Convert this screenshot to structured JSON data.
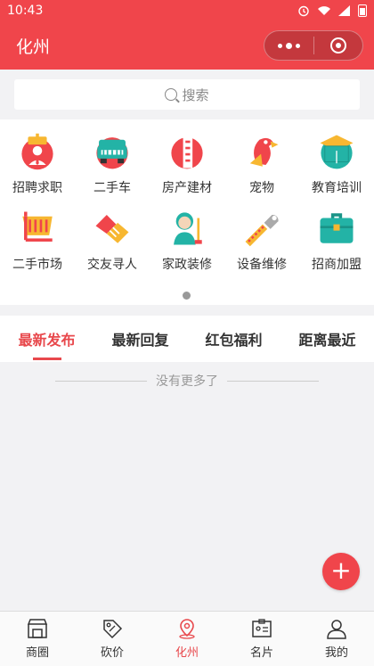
{
  "status": {
    "time": "10:43"
  },
  "header": {
    "title": "化州"
  },
  "search": {
    "placeholder": "搜索"
  },
  "categories": [
    {
      "label": "招聘求职",
      "icon": "job-icon"
    },
    {
      "label": "二手车",
      "icon": "car-icon"
    },
    {
      "label": "房产建材",
      "icon": "building-icon"
    },
    {
      "label": "宠物",
      "icon": "parrot-icon"
    },
    {
      "label": "教育培训",
      "icon": "book-icon"
    },
    {
      "label": "二手市场",
      "icon": "cart-icon"
    },
    {
      "label": "交友寻人",
      "icon": "handshake-icon"
    },
    {
      "label": "家政装修",
      "icon": "housekeeper-icon"
    },
    {
      "label": "设备维修",
      "icon": "wrench-icon"
    },
    {
      "label": "招商加盟",
      "icon": "briefcase-icon"
    }
  ],
  "tabs": [
    {
      "label": "最新发布",
      "active": true
    },
    {
      "label": "最新回复",
      "active": false
    },
    {
      "label": "红包福利",
      "active": false
    },
    {
      "label": "距离最近",
      "active": false
    }
  ],
  "feed": {
    "empty_text": "没有更多了"
  },
  "fab": {
    "label": "+"
  },
  "tabbar": [
    {
      "label": "商圈",
      "icon": "shop-icon",
      "active": false
    },
    {
      "label": "砍价",
      "icon": "tag-icon",
      "active": false
    },
    {
      "label": "化州",
      "icon": "location-icon",
      "active": true
    },
    {
      "label": "名片",
      "icon": "card-icon",
      "active": false
    },
    {
      "label": "我的",
      "icon": "user-icon",
      "active": false
    }
  ],
  "colors": {
    "brand": "#f0454b",
    "active_text": "#e8484c",
    "background": "#f2f2f4"
  }
}
